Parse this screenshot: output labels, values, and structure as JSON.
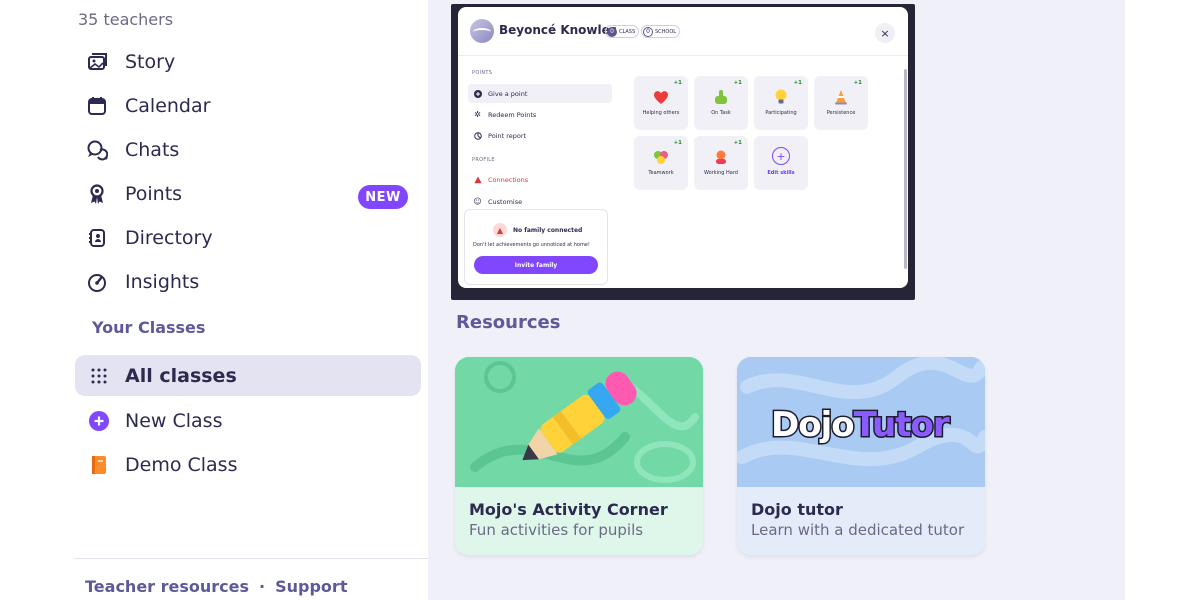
{
  "sidebar": {
    "teacher_count": "35 teachers",
    "nav": [
      {
        "label": "Story",
        "icon": "story-icon"
      },
      {
        "label": "Calendar",
        "icon": "calendar-icon"
      },
      {
        "label": "Chats",
        "icon": "chats-icon"
      },
      {
        "label": "Points",
        "icon": "points-icon",
        "badge": "NEW"
      },
      {
        "label": "Directory",
        "icon": "directory-icon"
      },
      {
        "label": "Insights",
        "icon": "insights-icon"
      }
    ],
    "classes_title": "Your Classes",
    "classes": [
      {
        "label": "All classes",
        "icon": "grid-icon",
        "active": true
      },
      {
        "label": "New Class",
        "icon": "plus-circle-icon"
      },
      {
        "label": "Demo Class",
        "icon": "book-icon"
      }
    ],
    "footer": {
      "resources": "Teacher resources",
      "separator": "·",
      "support": "Support"
    }
  },
  "preview": {
    "student_name": "Beyoncé Knowles",
    "class_count": "0",
    "class_label": "CLASS",
    "school_count": "0",
    "school_label": "SCHOOL",
    "close": "×",
    "points_section": "POINTS",
    "give_point": "Give a point",
    "redeem_points": "Redeem Points",
    "point_report": "Point report",
    "profile_section": "PROFILE",
    "connections": "Connections",
    "customise": "Customise",
    "family": {
      "title": "No family connected",
      "text": "Don't let achievements go unnoticed at home!",
      "button": "Invite family"
    },
    "skills": [
      {
        "name": "Helping others",
        "plus": "+1",
        "emoji": "❤️"
      },
      {
        "name": "On Task",
        "plus": "+1",
        "emoji": "👍"
      },
      {
        "name": "Participating",
        "plus": "+1",
        "emoji": "💡"
      },
      {
        "name": "Persistence",
        "plus": "+1",
        "emoji": "🔺"
      },
      {
        "name": "Teamwork",
        "plus": "+1",
        "emoji": "👥"
      },
      {
        "name": "Working Hard",
        "plus": "+1",
        "emoji": "💪"
      }
    ],
    "edit_skills": "Edit skills"
  },
  "resources": {
    "title": "Resources",
    "cards": [
      {
        "title": "Mojo's Activity Corner",
        "subtitle": "Fun activities for pupils"
      },
      {
        "title": "Dojo tutor",
        "subtitle": "Learn with a dedicated tutor",
        "logo_part1": "Dojo",
        "logo_part2": "Tutor"
      }
    ]
  },
  "colors": {
    "accent": "#8047ff",
    "text": "#2c2a50",
    "muted": "#5e5a9a",
    "main_bg": "#f0f0f8"
  }
}
